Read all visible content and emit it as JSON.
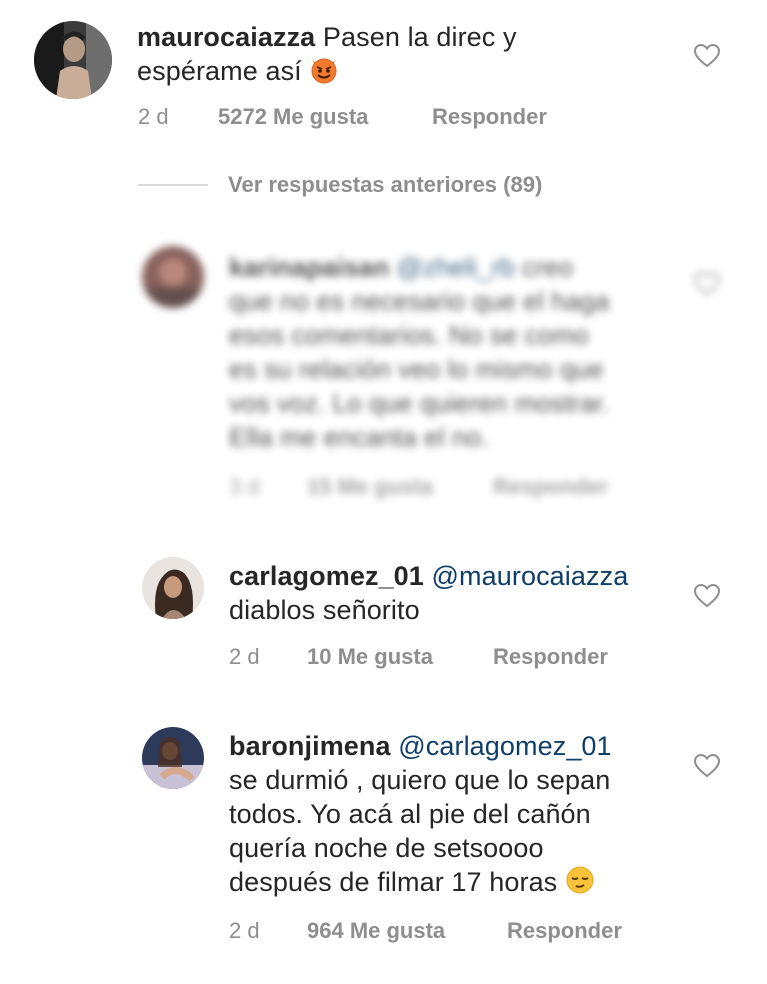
{
  "comments": [
    {
      "username": "maurocaiazza",
      "mention": "",
      "lines": [
        "Pasen la direc y",
        "espérame así"
      ],
      "emoji": "smiling-devil",
      "time": "2 d",
      "likes": "5272 Me gusta",
      "reply": "Responder"
    },
    {
      "username": "karinapaisan",
      "mention": "@zheli_rb",
      "lines": [
        "creo",
        "que no es necesario que el haga",
        "esos comentarios. No se como",
        "es su relación veo lo mismo que",
        "vos voz. Lo que quieren mostrar.",
        "Ella me encanta el no."
      ],
      "time": "3 d",
      "likes": "15 Me gusta",
      "reply": "Responder"
    },
    {
      "username": "carlagomez_01",
      "mention": "@maurocaiazza",
      "lines": [
        "diablos señorito"
      ],
      "time": "2 d",
      "likes": "10 Me gusta",
      "reply": "Responder"
    },
    {
      "username": "baronjimena",
      "mention": "@carlagomez_01",
      "lines": [
        "se durmió , quiero que lo sepan",
        "todos. Yo acá al pie del cañón",
        "quería noche de setsoooo",
        "después de filmar 17 horas"
      ],
      "emoji": "relieved-face",
      "time": "2 d",
      "likes": "964 Me gusta",
      "reply": "Responder"
    }
  ],
  "view_previous": "Ver respuestas anteriores (89)",
  "colors": {
    "text": "#262626",
    "meta": "#8e8e8e",
    "mention": "#0f3e69",
    "divider": "#dbdbdb"
  }
}
